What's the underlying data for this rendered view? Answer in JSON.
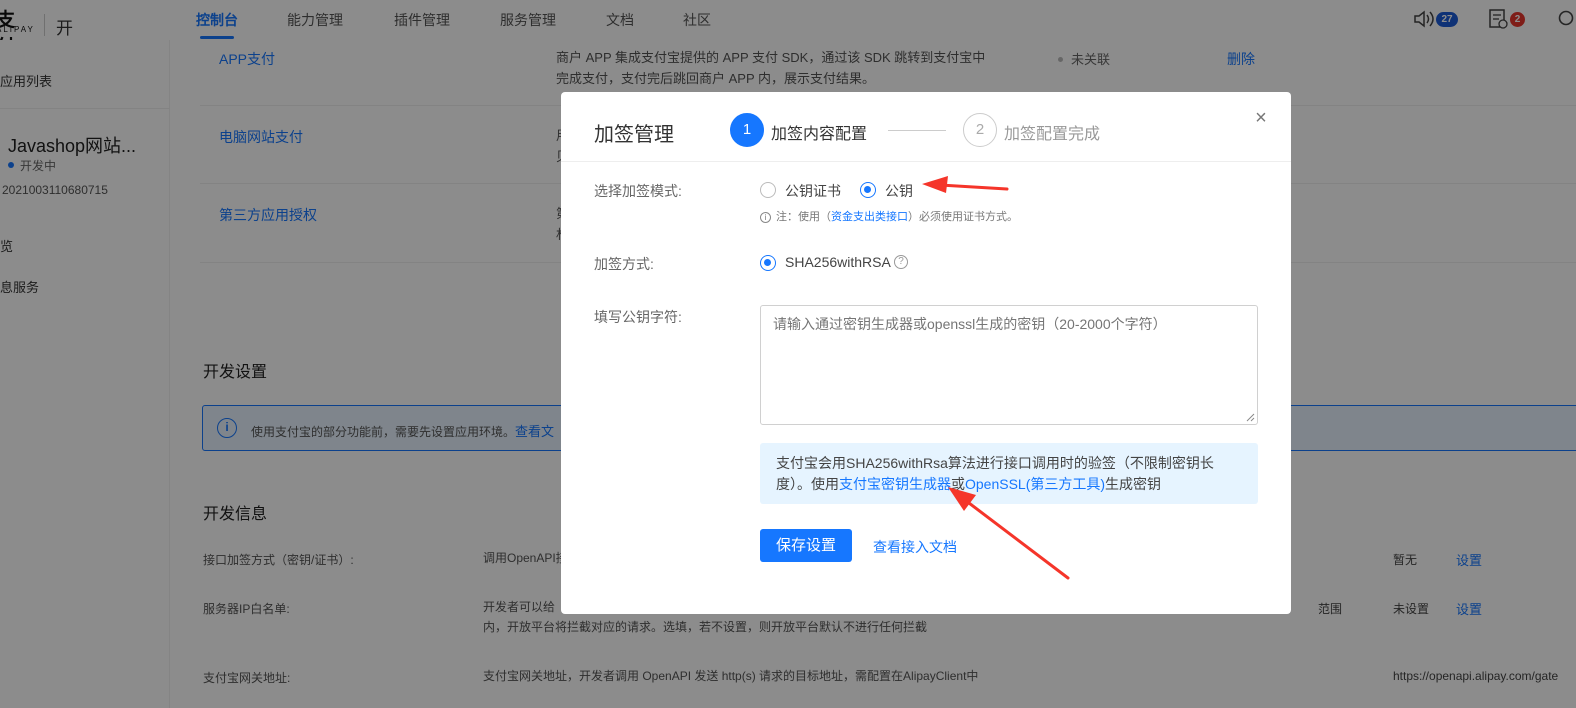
{
  "header": {
    "logo_main": "支付宝",
    "logo_sub": "ALIPAY",
    "platform": "开放平台",
    "nav": [
      {
        "label": "控制台"
      },
      {
        "label": "能力管理"
      },
      {
        "label": "插件管理"
      },
      {
        "label": "服务管理"
      },
      {
        "label": "文档"
      },
      {
        "label": "社区"
      }
    ],
    "notify_count": "27",
    "task_count": "2",
    "colors": {
      "accent": "#1677ff",
      "badge_blue": "#1d5bd8",
      "badge_red": "#e8362c"
    }
  },
  "sidebar": {
    "app_list": "应用列表",
    "app_name": "Javashop网站...",
    "app_status": "开发中",
    "app_id": "2021003110680715",
    "item_overview": "览",
    "item_msg": "息服务"
  },
  "products": [
    {
      "name": "APP支付",
      "desc": "商户 APP 集成支付宝提供的 APP 支付 SDK，通过该 SDK 跳转到支付宝中完成支付，支付完后跳回商户 APP 内，展示支付结果。",
      "desc_line1": "商户 APP 集成支付宝提供的 APP 支付 SDK，通过该 SDK 跳转到支付宝中",
      "desc_line2": "完成支付，支付完后跳回商户 APP 内，展示支付结果。",
      "status": "未关联",
      "action": "删除"
    },
    {
      "name": "电脑网站支付",
      "desc_line1": "用",
      "desc_line2": "贝"
    },
    {
      "name": "第三方应用授权",
      "desc_line1": "第",
      "desc_line2": "材"
    }
  ],
  "dev_settings": {
    "title": "开发设置",
    "info_text": "使用支付宝的部分功能前，需要先设置应用环境。",
    "info_link": "查看文"
  },
  "dev_info": {
    "title": "开发信息",
    "rows": [
      {
        "label": "接口加签方式（密钥/证书）:",
        "desc": "调用OpenAPI接",
        "value": "暂无",
        "action": "设置"
      },
      {
        "label": "服务器IP白名单:",
        "desc": "开发者可以给",
        "desc_line2": "内，开放平台将拦截对应的请求。选填，若不设置，则开放平台默认不进行任何拦截",
        "extra": "范围",
        "value": "未设置",
        "action": "设置"
      },
      {
        "label": "支付宝网关地址:",
        "desc": "支付宝网关地址，开发者调用 OpenAPI 发送 http(s) 请求的目标地址，需配置在AlipayClient中",
        "value": "https://openapi.alipay.com/gate"
      }
    ]
  },
  "modal": {
    "title": "加签管理",
    "step1_num": "1",
    "step1_label": "加签内容配置",
    "step2_num": "2",
    "step2_label": "加签配置完成",
    "close": "×",
    "mode_label": "选择加签模式:",
    "mode_options": [
      {
        "label": "公钥证书",
        "selected": false
      },
      {
        "label": "公钥",
        "selected": true
      }
    ],
    "note_prefix": "注：使用（",
    "note_link": "资金支出类接口",
    "note_suffix": "）必须使用证书方式。",
    "method_label": "加签方式:",
    "method_option": "SHA256withRSA",
    "method_help": "?",
    "key_label": "填写公钥字符:",
    "key_placeholder": "请输入通过密钥生成器或openssl生成的密钥（20-2000个字符）",
    "key_value": "",
    "tip_text_1": "支付宝会用SHA256withRsa算法进行接口调用时的验签（不限制密钥长度）。使用",
    "tip_link_1": "支付宝密钥生成器",
    "tip_mid": "或",
    "tip_link_2": "OpenSSL(第三方工具)",
    "tip_text_2": "生成密钥",
    "save_button": "保存设置",
    "doc_link": "查看接入文档"
  },
  "annotation_arrows": {
    "color": "#f5352a"
  }
}
